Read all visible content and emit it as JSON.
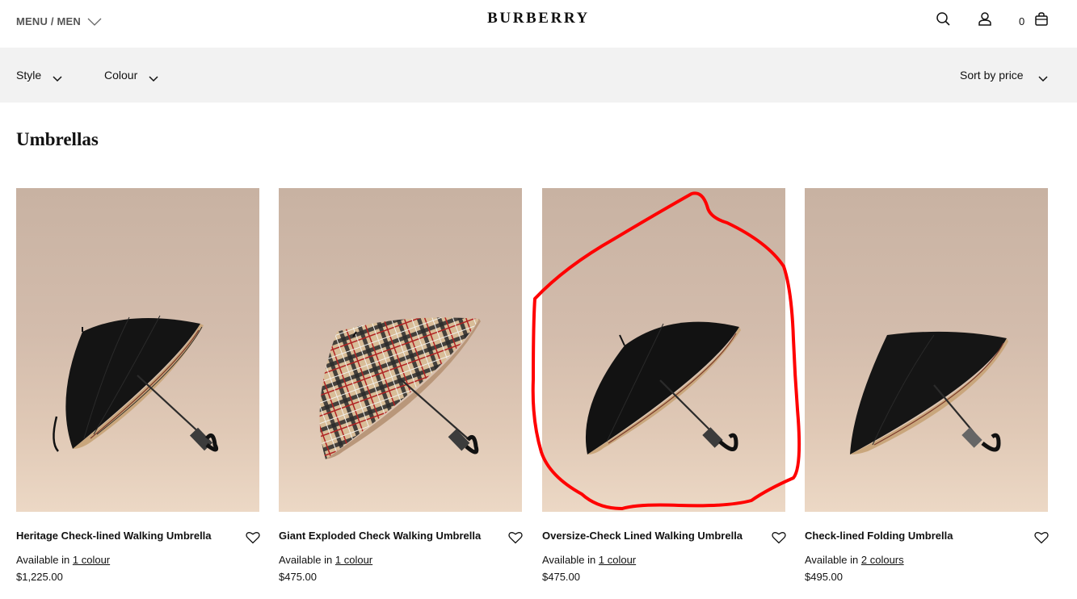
{
  "header": {
    "menu_label": "MENU / MEN",
    "logo": "BURBERRY",
    "bag_count": "0",
    "icons": [
      "search-icon",
      "account-icon",
      "bag-icon",
      "chevron-down-icon"
    ]
  },
  "filters": {
    "style_label": "Style",
    "colour_label": "Colour",
    "sort_label": "Sort by price"
  },
  "page": {
    "title": "Umbrellas"
  },
  "products": [
    {
      "name": "Heritage Check-lined Walking Umbrella",
      "available_prefix": "Available in",
      "available_link": "1 colour",
      "price": "$1,225.00"
    },
    {
      "name": "Giant Exploded Check Walking Umbrella",
      "available_prefix": "Available in",
      "available_link": "1 colour",
      "price": "$475.00"
    },
    {
      "name": "Oversize-Check Lined Walking Umbrella",
      "available_prefix": "Available in",
      "available_link": "1 colour",
      "price": "$475.00"
    },
    {
      "name": "Check-lined Folding Umbrella",
      "available_prefix": "Available in",
      "available_link": "2 colours",
      "price": "$495.00"
    }
  ],
  "colors": {
    "filter_bar_bg": "#f2f2f2",
    "annotation": "#ff0000",
    "check_beige": "#d8bd98"
  }
}
